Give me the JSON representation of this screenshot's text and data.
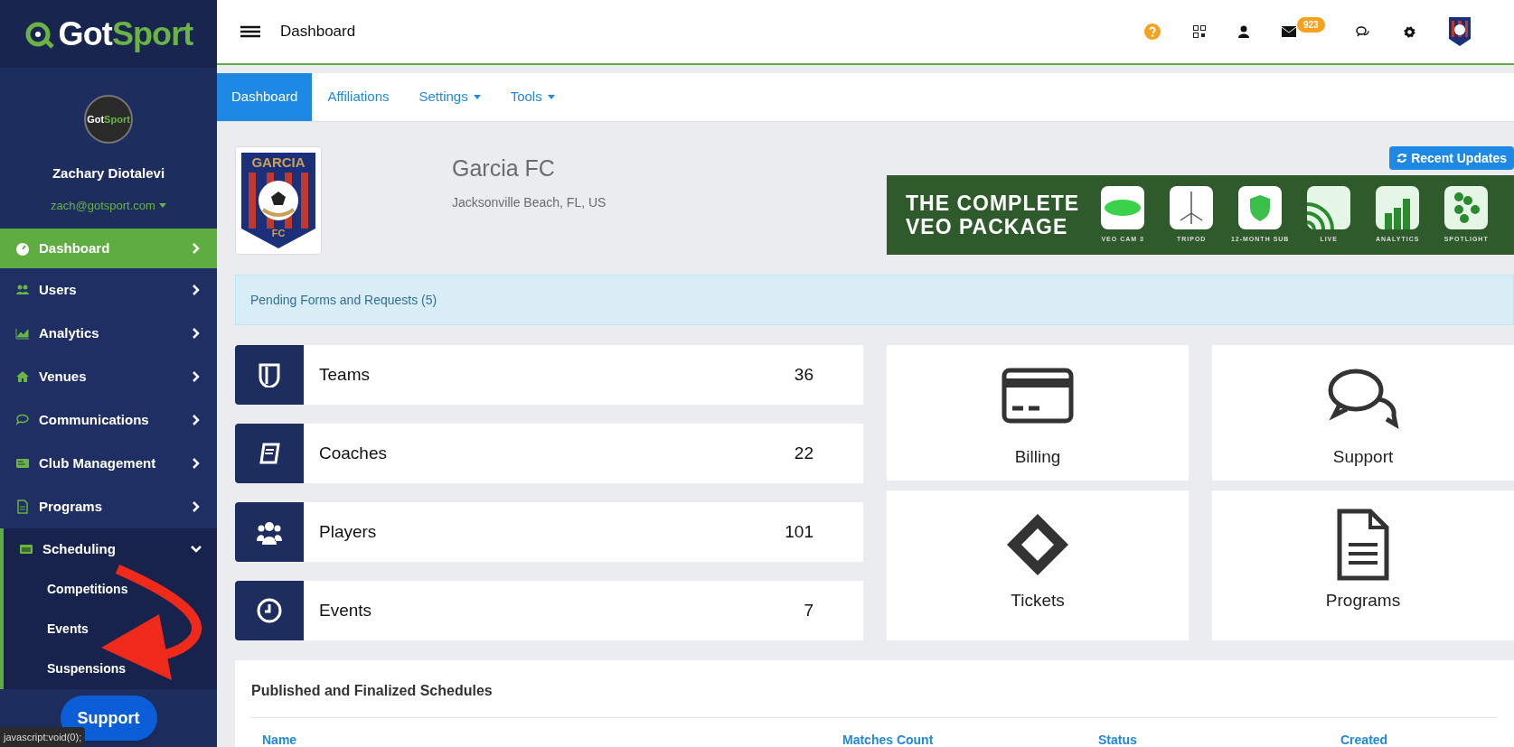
{
  "sidebar": {
    "logo": [
      "Got",
      "Sport"
    ],
    "avatar_logo": [
      "Got",
      "Sport"
    ],
    "user_name": "Zachary Diotalevi",
    "email": "zach@gotsport.com",
    "items": [
      {
        "label": "Dashboard",
        "selected": true,
        "expanded": false
      },
      {
        "label": "Users",
        "selected": false,
        "expanded": false
      },
      {
        "label": "Analytics",
        "selected": false,
        "expanded": false
      },
      {
        "label": "Venues",
        "selected": false,
        "expanded": false
      },
      {
        "label": "Communications",
        "selected": false,
        "expanded": false
      },
      {
        "label": "Club Management",
        "selected": false,
        "expanded": false
      },
      {
        "label": "Programs",
        "selected": false,
        "expanded": false
      },
      {
        "label": "Scheduling",
        "selected": false,
        "expanded": true,
        "children": [
          {
            "label": "Competitions"
          },
          {
            "label": "Events"
          },
          {
            "label": "Suspensions"
          }
        ]
      }
    ],
    "support_button": "Support",
    "link_preview": "javascript:void(0);"
  },
  "top_bar": {
    "title": "Dashboard",
    "mail_badge": "923"
  },
  "tabs": [
    {
      "label": "Dashboard",
      "selected": true,
      "dropdown": false
    },
    {
      "label": "Affiliations",
      "selected": false,
      "dropdown": false
    },
    {
      "label": "Settings",
      "selected": false,
      "dropdown": true
    },
    {
      "label": "Tools",
      "selected": false,
      "dropdown": true
    }
  ],
  "club": {
    "crest": [
      "GARCIA",
      "FC"
    ],
    "name": "Garcia FC",
    "location": "Jacksonville Beach, FL, US",
    "recent_updates_button": "Recent Updates"
  },
  "ad": {
    "headline": [
      "THE COMPLETE",
      "VEO PACKAGE"
    ],
    "products": [
      "VEO CAM 3",
      "TRIPOD",
      "12-MONTH SUB",
      "LIVE",
      "ANALYTICS",
      "SPOTLIGHT"
    ]
  },
  "alert": "Pending Forms and Requests (5)",
  "stats": [
    {
      "label": "Teams",
      "count": "36"
    },
    {
      "label": "Coaches",
      "count": "22"
    },
    {
      "label": "Players",
      "count": "101"
    },
    {
      "label": "Events",
      "count": "7"
    }
  ],
  "tiles": [
    {
      "label": "Billing"
    },
    {
      "label": "Support"
    },
    {
      "label": "Tickets"
    },
    {
      "label": "Programs"
    }
  ],
  "schedules": {
    "title": "Published and Finalized Schedules",
    "columns": [
      "Name",
      "Matches Count",
      "Status",
      "Created"
    ]
  }
}
